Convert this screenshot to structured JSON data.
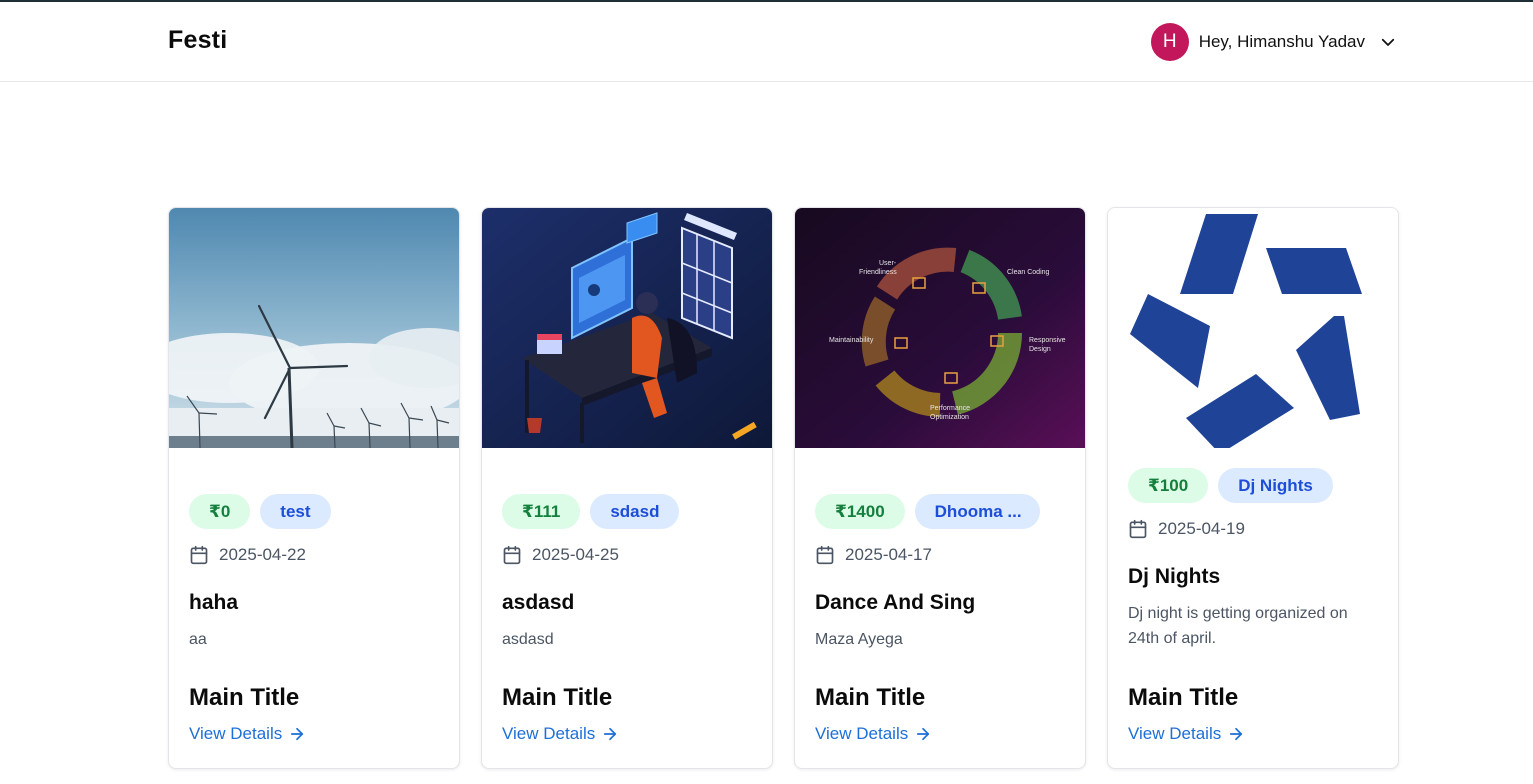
{
  "header": {
    "brand": "Festi",
    "avatar_initial": "H",
    "greeting": "Hey, Himanshu Yadav"
  },
  "colors": {
    "avatar": "#c2185b",
    "price_tag_bg": "#dcfce7",
    "price_tag_text": "#15803d",
    "category_tag_bg": "#dbeafe",
    "category_tag_text": "#1d4ed8",
    "link": "#1d6fd8"
  },
  "events": [
    {
      "image": "wind-turbines-photo",
      "price": "₹0",
      "category": "test",
      "date": "2025-04-22",
      "title": "haha",
      "description": "aa",
      "main_title": "Main Title",
      "link_label": "View Details"
    },
    {
      "image": "developer-at-desk-illustration",
      "price": "₹111",
      "category": "sdasd",
      "date": "2025-04-25",
      "title": "asdasd",
      "description": "asdasd",
      "main_title": "Main Title",
      "link_label": "View Details"
    },
    {
      "image": "development-cycle-diagram",
      "image_labels": [
        "User-",
        "Friendliness",
        "Clean Coding",
        "Maintainability",
        "Responsive",
        "Design",
        "Performance",
        "Optimization"
      ],
      "price": "₹1400",
      "category": "Dhooma ...",
      "date": "2025-04-17",
      "title": "Dance And Sing",
      "description": "Maza Ayega",
      "main_title": "Main Title",
      "link_label": "View Details"
    },
    {
      "image": "blue-star-logo",
      "price": "₹100",
      "category": "Dj Nights",
      "date": "2025-04-19",
      "title": "Dj Nights",
      "description": "Dj night is getting organized on 24th of april.",
      "main_title": "Main Title",
      "link_label": "View Details"
    }
  ]
}
